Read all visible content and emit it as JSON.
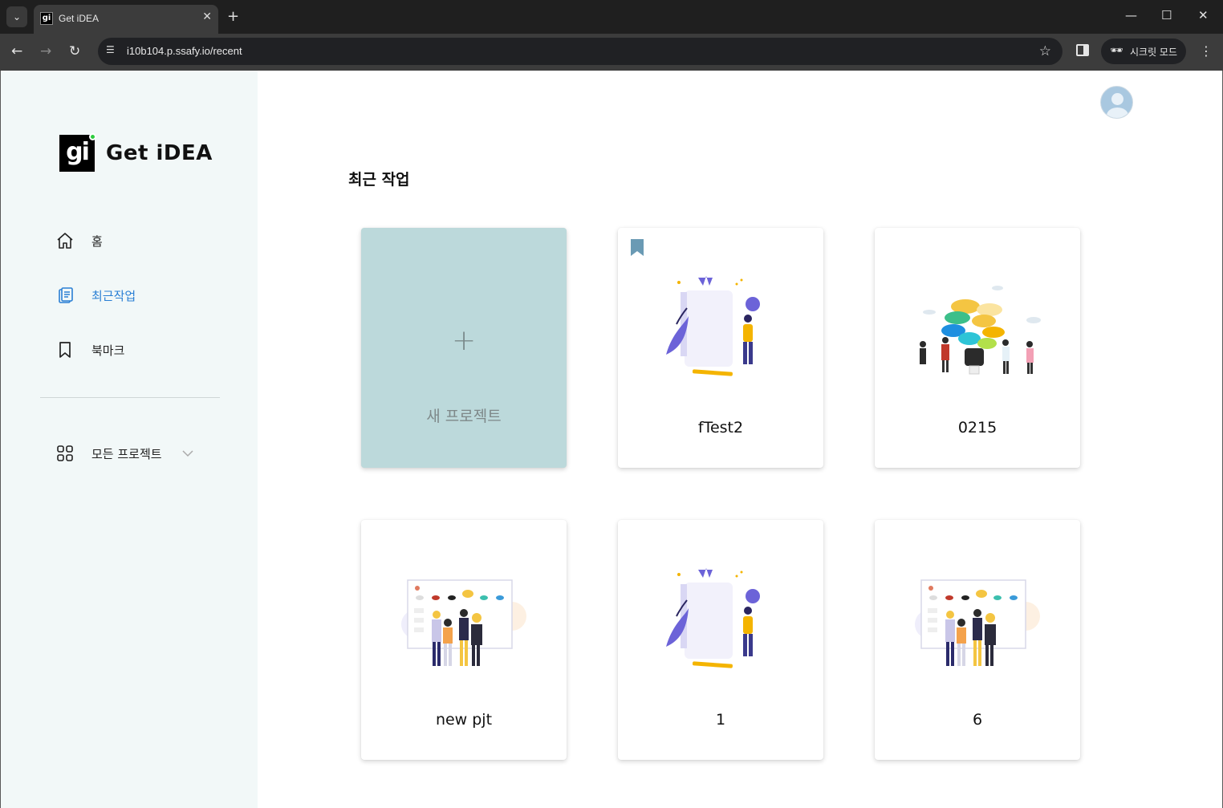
{
  "browser": {
    "tab_title": "Get iDEA",
    "favicon_text": "gi",
    "url": "i10b104.p.ssafy.io/recent",
    "incognito_label": "시크릿 모드"
  },
  "sidebar": {
    "logo_mark": "gi",
    "logo_text": "Get iDEA",
    "nav": {
      "home": "홈",
      "recent": "최근작업",
      "bookmark": "북마크",
      "all_projects": "모든 프로젝트"
    }
  },
  "main": {
    "title": "최근 작업",
    "new_project": {
      "plus": "+",
      "label": "새 프로젝트"
    },
    "projects": [
      {
        "name": "fTest2",
        "bookmarked": true,
        "illustration": "whiteboard-person"
      },
      {
        "name": "0215",
        "bookmarked": false,
        "illustration": "idea-tree-people"
      },
      {
        "name": "new pjt",
        "bookmarked": false,
        "illustration": "team-board"
      },
      {
        "name": "1",
        "bookmarked": false,
        "illustration": "whiteboard-person"
      },
      {
        "name": "6",
        "bookmarked": false,
        "illustration": "team-board"
      }
    ]
  },
  "colors": {
    "sidebar_bg": "#f2f8f8",
    "active_nav": "#2a7fd4",
    "new_card_bg": "#bcd9db",
    "bookmark": "#6a9ab4"
  }
}
